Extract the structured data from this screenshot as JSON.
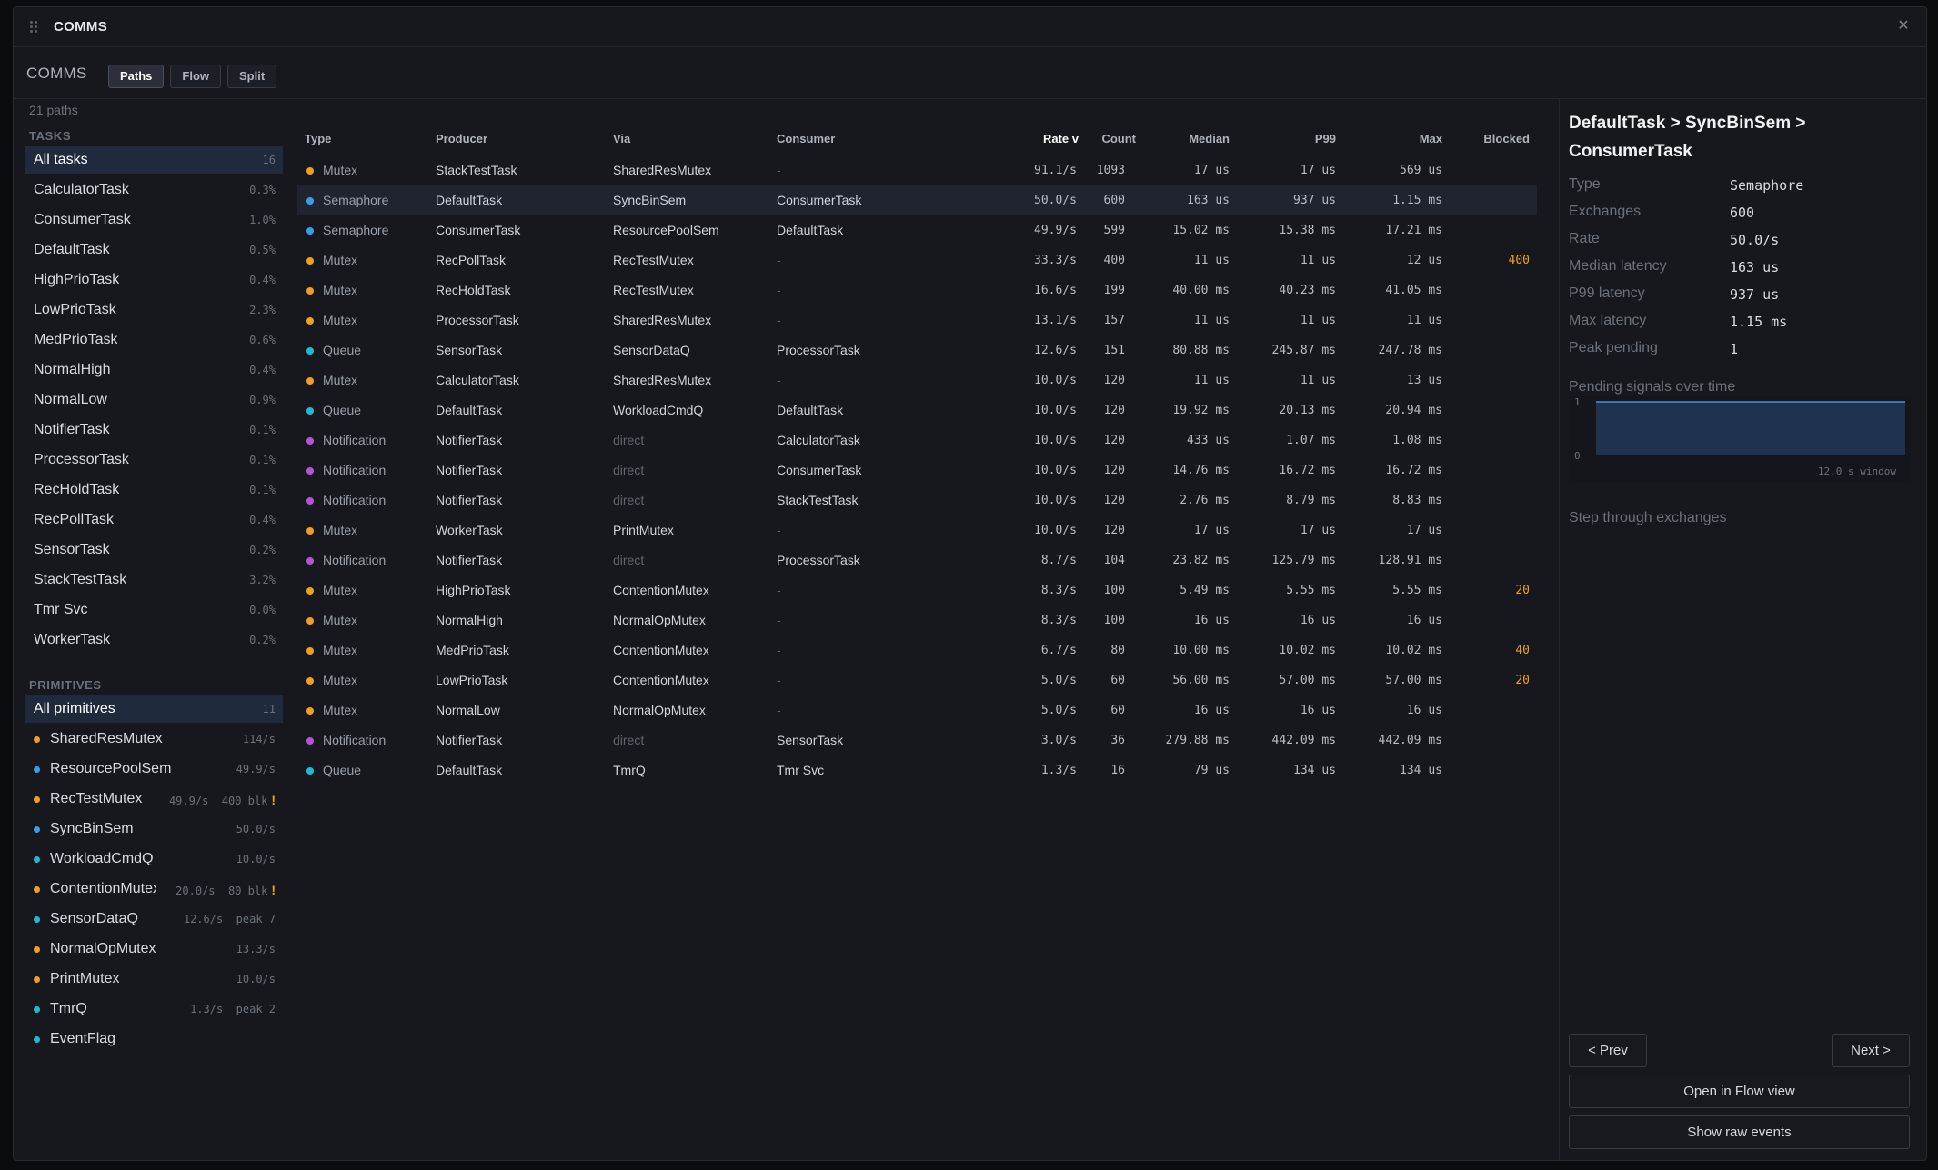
{
  "window": {
    "title": "COMMS"
  },
  "toolbar": {
    "title": "COMMS",
    "tabs": [
      {
        "label": "Paths",
        "active": true
      },
      {
        "label": "Flow",
        "active": false
      },
      {
        "label": "Split",
        "active": false
      }
    ]
  },
  "sidebar": {
    "path_count": "21 paths",
    "tasks_header": "TASKS",
    "tasks": [
      {
        "label": "All tasks",
        "value": "16",
        "selected": true
      },
      {
        "label": "CalculatorTask",
        "value": "0.3%"
      },
      {
        "label": "ConsumerTask",
        "value": "1.0%"
      },
      {
        "label": "DefaultTask",
        "value": "0.5%"
      },
      {
        "label": "HighPrioTask",
        "value": "0.4%"
      },
      {
        "label": "LowPrioTask",
        "value": "2.3%"
      },
      {
        "label": "MedPrioTask",
        "value": "0.6%"
      },
      {
        "label": "NormalHigh",
        "value": "0.4%"
      },
      {
        "label": "NormalLow",
        "value": "0.9%"
      },
      {
        "label": "NotifierTask",
        "value": "0.1%"
      },
      {
        "label": "ProcessorTask",
        "value": "0.1%"
      },
      {
        "label": "RecHoldTask",
        "value": "0.1%"
      },
      {
        "label": "RecPollTask",
        "value": "0.4%"
      },
      {
        "label": "SensorTask",
        "value": "0.2%"
      },
      {
        "label": "StackTestTask",
        "value": "3.2%"
      },
      {
        "label": "Tmr Svc",
        "value": "0.0%"
      },
      {
        "label": "WorkerTask",
        "value": "0.2%"
      }
    ],
    "primitives_header": "PRIMITIVES",
    "primitives": [
      {
        "label": "All primitives",
        "value": "11",
        "selected": true,
        "color": ""
      },
      {
        "label": "SharedResMutex",
        "value": "114/s",
        "color": "#f0a020"
      },
      {
        "label": "ResourcePoolSem",
        "value": "49.9/s",
        "color": "#3b9de6"
      },
      {
        "label": "RecTestMutex",
        "value": "49.9/s  400 blk",
        "color": "#f0a020",
        "warn": "!"
      },
      {
        "label": "SyncBinSem",
        "value": "50.0/s",
        "color": "#3b9de6"
      },
      {
        "label": "WorkloadCmdQ",
        "value": "10.0/s",
        "color": "#22b8cf"
      },
      {
        "label": "ContentionMutex",
        "value": "20.0/s  80 blk",
        "color": "#f0a020",
        "warn": "!"
      },
      {
        "label": "SensorDataQ",
        "value": "12.6/s  peak 7",
        "color": "#22b8cf"
      },
      {
        "label": "NormalOpMutex",
        "value": "13.3/s",
        "color": "#f0a020"
      },
      {
        "label": "PrintMutex",
        "value": "10.0/s",
        "color": "#f0a020"
      },
      {
        "label": "TmrQ",
        "value": "1.3/s  peak 2",
        "color": "#22b8cf"
      },
      {
        "label": "EventFlag",
        "value": "",
        "color": "#22b8cf"
      }
    ]
  },
  "colors": {
    "Mutex": "#f0a020",
    "Semaphore": "#3b9de6",
    "Queue": "#22b8cf",
    "Notification": "#b455d6"
  },
  "table": {
    "headers": [
      "Type",
      "Producer",
      "Via",
      "Consumer",
      "Rate v",
      "Count",
      "Median",
      "P99",
      "Max",
      "Blocked"
    ],
    "rows": [
      {
        "type": "Mutex",
        "producer": "StackTestTask",
        "via": "SharedResMutex",
        "consumer": "-",
        "rate": "91.1/s",
        "count": "1093",
        "median": "17 us",
        "p99": "17 us",
        "max": "569 us",
        "blocked": ""
      },
      {
        "type": "Semaphore",
        "producer": "DefaultTask",
        "via": "SyncBinSem",
        "consumer": "ConsumerTask",
        "rate": "50.0/s",
        "count": "600",
        "median": "163 us",
        "p99": "937 us",
        "max": "1.15 ms",
        "blocked": "",
        "selected": true
      },
      {
        "type": "Semaphore",
        "producer": "ConsumerTask",
        "via": "ResourcePoolSem",
        "consumer": "DefaultTask",
        "rate": "49.9/s",
        "count": "599",
        "median": "15.02 ms",
        "p99": "15.38 ms",
        "max": "17.21 ms",
        "blocked": ""
      },
      {
        "type": "Mutex",
        "producer": "RecPollTask",
        "via": "RecTestMutex",
        "consumer": "-",
        "rate": "33.3/s",
        "count": "400",
        "median": "11 us",
        "p99": "11 us",
        "max": "12 us",
        "blocked": "400"
      },
      {
        "type": "Mutex",
        "producer": "RecHoldTask",
        "via": "RecTestMutex",
        "consumer": "-",
        "rate": "16.6/s",
        "count": "199",
        "median": "40.00 ms",
        "p99": "40.23 ms",
        "max": "41.05 ms",
        "blocked": ""
      },
      {
        "type": "Mutex",
        "producer": "ProcessorTask",
        "via": "SharedResMutex",
        "consumer": "-",
        "rate": "13.1/s",
        "count": "157",
        "median": "11 us",
        "p99": "11 us",
        "max": "11 us",
        "blocked": ""
      },
      {
        "type": "Queue",
        "producer": "SensorTask",
        "via": "SensorDataQ",
        "consumer": "ProcessorTask",
        "rate": "12.6/s",
        "count": "151",
        "median": "80.88 ms",
        "p99": "245.87 ms",
        "max": "247.78 ms",
        "blocked": ""
      },
      {
        "type": "Mutex",
        "producer": "CalculatorTask",
        "via": "SharedResMutex",
        "consumer": "-",
        "rate": "10.0/s",
        "count": "120",
        "median": "11 us",
        "p99": "11 us",
        "max": "13 us",
        "blocked": ""
      },
      {
        "type": "Queue",
        "producer": "DefaultTask",
        "via": "WorkloadCmdQ",
        "consumer": "DefaultTask",
        "rate": "10.0/s",
        "count": "120",
        "median": "19.92 ms",
        "p99": "20.13 ms",
        "max": "20.94 ms",
        "blocked": ""
      },
      {
        "type": "Notification",
        "producer": "NotifierTask",
        "via": "direct",
        "consumer": "CalculatorTask",
        "rate": "10.0/s",
        "count": "120",
        "median": "433 us",
        "p99": "1.07 ms",
        "max": "1.08 ms",
        "blocked": ""
      },
      {
        "type": "Notification",
        "producer": "NotifierTask",
        "via": "direct",
        "consumer": "ConsumerTask",
        "rate": "10.0/s",
        "count": "120",
        "median": "14.76 ms",
        "p99": "16.72 ms",
        "max": "16.72 ms",
        "blocked": ""
      },
      {
        "type": "Notification",
        "producer": "NotifierTask",
        "via": "direct",
        "consumer": "StackTestTask",
        "rate": "10.0/s",
        "count": "120",
        "median": "2.76 ms",
        "p99": "8.79 ms",
        "max": "8.83 ms",
        "blocked": ""
      },
      {
        "type": "Mutex",
        "producer": "WorkerTask",
        "via": "PrintMutex",
        "consumer": "-",
        "rate": "10.0/s",
        "count": "120",
        "median": "17 us",
        "p99": "17 us",
        "max": "17 us",
        "blocked": ""
      },
      {
        "type": "Notification",
        "producer": "NotifierTask",
        "via": "direct",
        "consumer": "ProcessorTask",
        "rate": "8.7/s",
        "count": "104",
        "median": "23.82 ms",
        "p99": "125.79 ms",
        "max": "128.91 ms",
        "blocked": ""
      },
      {
        "type": "Mutex",
        "producer": "HighPrioTask",
        "via": "ContentionMutex",
        "consumer": "-",
        "rate": "8.3/s",
        "count": "100",
        "median": "5.49 ms",
        "p99": "5.55 ms",
        "max": "5.55 ms",
        "blocked": "20"
      },
      {
        "type": "Mutex",
        "producer": "NormalHigh",
        "via": "NormalOpMutex",
        "consumer": "-",
        "rate": "8.3/s",
        "count": "100",
        "median": "16 us",
        "p99": "16 us",
        "max": "16 us",
        "blocked": ""
      },
      {
        "type": "Mutex",
        "producer": "MedPrioTask",
        "via": "ContentionMutex",
        "consumer": "-",
        "rate": "6.7/s",
        "count": "80",
        "median": "10.00 ms",
        "p99": "10.02 ms",
        "max": "10.02 ms",
        "blocked": "40"
      },
      {
        "type": "Mutex",
        "producer": "LowPrioTask",
        "via": "ContentionMutex",
        "consumer": "-",
        "rate": "5.0/s",
        "count": "60",
        "median": "56.00 ms",
        "p99": "57.00 ms",
        "max": "57.00 ms",
        "blocked": "20"
      },
      {
        "type": "Mutex",
        "producer": "NormalLow",
        "via": "NormalOpMutex",
        "consumer": "-",
        "rate": "5.0/s",
        "count": "60",
        "median": "16 us",
        "p99": "16 us",
        "max": "16 us",
        "blocked": ""
      },
      {
        "type": "Notification",
        "producer": "NotifierTask",
        "via": "direct",
        "consumer": "SensorTask",
        "rate": "3.0/s",
        "count": "36",
        "median": "279.88 ms",
        "p99": "442.09 ms",
        "max": "442.09 ms",
        "blocked": ""
      },
      {
        "type": "Queue",
        "producer": "DefaultTask",
        "via": "TmrQ",
        "consumer": "Tmr Svc",
        "rate": "1.3/s",
        "count": "16",
        "median": "79 us",
        "p99": "134 us",
        "max": "134 us",
        "blocked": ""
      }
    ]
  },
  "detail": {
    "title": "DefaultTask > SyncBinSem > ConsumerTask",
    "fields": [
      {
        "key": "Type",
        "value": "Semaphore"
      },
      {
        "key": "Exchanges",
        "value": "600"
      },
      {
        "key": "Rate",
        "value": "50.0/s"
      },
      {
        "key": "Median latency",
        "value": "163 us"
      },
      {
        "key": "P99 latency",
        "value": "937 us"
      },
      {
        "key": "Max latency",
        "value": "1.15 ms"
      },
      {
        "key": "Peak pending",
        "value": "1"
      }
    ],
    "chart_label": "Pending signals over time",
    "chart_data": {
      "type": "area",
      "y_ticks": [
        "1",
        "0"
      ],
      "ylim": [
        0,
        1
      ],
      "x": [
        0,
        12.0
      ],
      "values": [
        1,
        1
      ],
      "window_label": "12.0 s window"
    },
    "step_label": "Step through exchanges",
    "prev_label": "< Prev",
    "next_label": "Next >",
    "flow_label": "Open in Flow view",
    "raw_label": "Show raw events"
  }
}
